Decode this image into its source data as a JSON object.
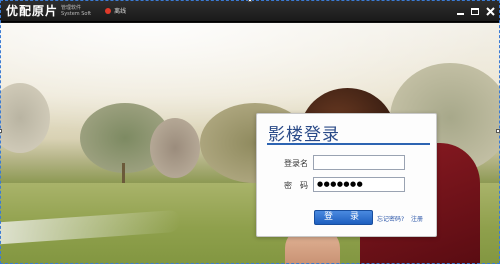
{
  "titlebar": {
    "logo_main": "优配原片",
    "logo_sub_1": "管理软件",
    "logo_sub_2": "System Soft",
    "network_status": "离线",
    "status_color": "#e03a2a",
    "minimize_icon": "minimize-icon",
    "maximize_icon": "maximize-icon",
    "close_icon": "close-icon"
  },
  "login": {
    "title": "影楼登录",
    "username_label": "登录名",
    "username_value": "",
    "password_label": "密　码",
    "password_value": "●●●●●●●",
    "login_button": "登　录",
    "forgot_link": "忘记密码?",
    "register_link": "注册",
    "accent_color": "#2d64b2"
  }
}
